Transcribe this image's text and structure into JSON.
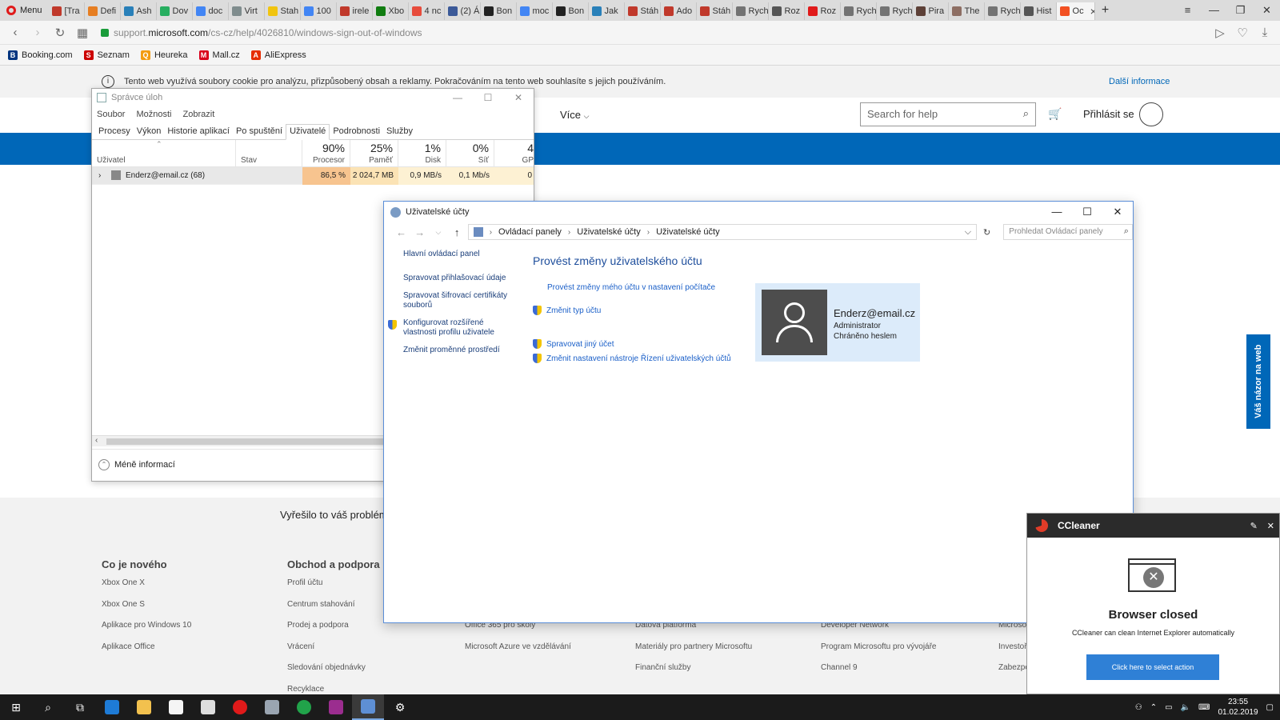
{
  "browser": {
    "menu_label": "Menu",
    "tabs": [
      {
        "label": "[Tra",
        "color": "#c0392b"
      },
      {
        "label": "Defi",
        "color": "#e67e22"
      },
      {
        "label": "Ash",
        "color": "#2980b9"
      },
      {
        "label": "Dov",
        "color": "#27ae60"
      },
      {
        "label": "doc",
        "color": "#4285f4"
      },
      {
        "label": "Virt",
        "color": "#7f8c8d"
      },
      {
        "label": "Stah",
        "color": "#f1c40f"
      },
      {
        "label": "100",
        "color": "#4285f4"
      },
      {
        "label": "irele",
        "color": "#c0392b"
      },
      {
        "label": "Xbo",
        "color": "#107c10"
      },
      {
        "label": "4 nc",
        "color": "#e74c3c"
      },
      {
        "label": "(2) Á",
        "color": "#3b5998"
      },
      {
        "label": "Bon",
        "color": "#222222"
      },
      {
        "label": "moc",
        "color": "#4285f4"
      },
      {
        "label": "Bon",
        "color": "#222222"
      },
      {
        "label": "Jak",
        "color": "#2980b9"
      },
      {
        "label": "Stáh",
        "color": "#c0392b"
      },
      {
        "label": "Ado",
        "color": "#c0392b"
      },
      {
        "label": "Stáh",
        "color": "#c0392b"
      },
      {
        "label": "Rych",
        "color": "#737373"
      },
      {
        "label": "Roz",
        "color": "#555555"
      },
      {
        "label": "Roz",
        "color": "#e01a1a"
      },
      {
        "label": "Rych",
        "color": "#737373"
      },
      {
        "label": "Rych",
        "color": "#737373"
      },
      {
        "label": "Pira",
        "color": "#5d4037"
      },
      {
        "label": "The",
        "color": "#8d6e63"
      },
      {
        "label": "Rych",
        "color": "#737373"
      },
      {
        "label": "Hist",
        "color": "#555555"
      }
    ],
    "active_tab": {
      "label": "Oc",
      "color": "#f25022"
    },
    "url_prefix": "support.",
    "url_domain": "microsoft.com",
    "url_path": "/cs-cz/help/4026810/windows-sign-out-of-windows",
    "bookmarks": [
      {
        "label": "Booking.com",
        "icon": "B",
        "color": "#003580"
      },
      {
        "label": "Seznam",
        "icon": "S",
        "color": "#cc0000"
      },
      {
        "label": "Heureka",
        "icon": "Q",
        "color": "#f39c12"
      },
      {
        "label": "Mall.cz",
        "icon": "M",
        "color": "#d9001b"
      },
      {
        "label": "AliExpress",
        "icon": "A",
        "color": "#e62e04"
      }
    ]
  },
  "page": {
    "cookie_text": "Tento web využívá soubory cookie pro analýzu, přizpůsobený obsah a reklamy. Pokračováním na tento web souhlasíte s jejich používáním.",
    "cookie_more": "Další informace",
    "more_label": "Více",
    "search_placeholder": "Search for help",
    "sign_in": "Přihlásit se",
    "feedback_question": "Vyřešilo to váš problém",
    "side_feedback": "Váš názor na web",
    "footer": {
      "col1": {
        "title": "Co je nového",
        "links": [
          "Xbox One X",
          "Xbox One S",
          "Aplikace pro Windows 10",
          "Aplikace Office"
        ]
      },
      "col2": {
        "title": "Obchod a podpora",
        "links": [
          "Profil účtu",
          "Centrum stahování",
          "Prodej a podpora",
          "Vrácení",
          "Sledování objednávky",
          "Recyklace"
        ]
      },
      "col3": {
        "links": [
          "Office 365 pro školy",
          "Microsoft Azure ve vzdělávání"
        ]
      },
      "col4": {
        "links": [
          "Datová platforma",
          "Materiály pro partnery Microsoftu",
          "Finanční služby"
        ]
      },
      "col5": {
        "links": [
          "Developer Network",
          "Program Microsoftu pro vývojáře",
          "Channel 9"
        ]
      },
      "col6": {
        "links": [
          "Microso",
          "Investoři",
          "Zabezpe"
        ]
      }
    }
  },
  "taskmgr": {
    "title": "Správce úloh",
    "menu": [
      "Soubor",
      "Možnosti",
      "Zobrazit"
    ],
    "tabs": [
      "Procesy",
      "Výkon",
      "Historie aplikací",
      "Po spuštění",
      "Uživatelé",
      "Podrobnosti",
      "Služby"
    ],
    "active_tab": "Uživatelé",
    "col_user": "Uživatel",
    "col_status": "Stav",
    "cols": [
      {
        "pct": "90%",
        "label": "Procesor"
      },
      {
        "pct": "25%",
        "label": "Paměť"
      },
      {
        "pct": "1%",
        "label": "Disk"
      },
      {
        "pct": "0%",
        "label": "Síť"
      },
      {
        "pct": "4",
        "label": "GP"
      }
    ],
    "row": {
      "user": "Enderz@email.cz (68)",
      "cpu": "86,5 %",
      "mem": "2 024,7 MB",
      "disk": "0,9 MB/s",
      "net": "0,1 Mb/s",
      "gpu": "0"
    },
    "heat_colors": {
      "cpu": "#f7c48f",
      "mem": "#fbe3b5",
      "disk": "#fdf1d3",
      "net": "#fdf1d3",
      "gpu": "#fdf1d3"
    },
    "less_info": "Méně informací"
  },
  "useracc": {
    "title": "Uživatelské účty",
    "crumbs": [
      "Ovládací panely",
      "Uživatelské účty",
      "Uživatelské účty"
    ],
    "search_placeholder": "Prohledat Ovládací panely",
    "left_links": [
      "Hlavní ovládací panel",
      "Spravovat přihlašovací údaje",
      "Spravovat šifrovací certifikáty souborů",
      "Konfigurovat rozšířené vlastnosti profilu uživatele",
      "Změnit proměnné prostředí"
    ],
    "heading": "Provést změny uživatelského účtu",
    "link_pc_settings": "Provést změny mého účtu v nastavení počítače",
    "link_change_type": "Změnit typ účtu",
    "link_manage_other": "Spravovat jiný účet",
    "link_uac": "Změnit nastavení nástroje Řízení uživatelských účtů",
    "account": {
      "email": "Enderz@email.cz",
      "role": "Administrator",
      "protection": "Chráněno heslem"
    }
  },
  "ccleaner": {
    "app_name": "CCleaner",
    "heading": "Browser closed",
    "subtext": "CCleaner can clean Internet Explorer automatically",
    "button": "Click here to select action"
  },
  "taskbar": {
    "time": "23:55",
    "date": "01.02.2019"
  }
}
